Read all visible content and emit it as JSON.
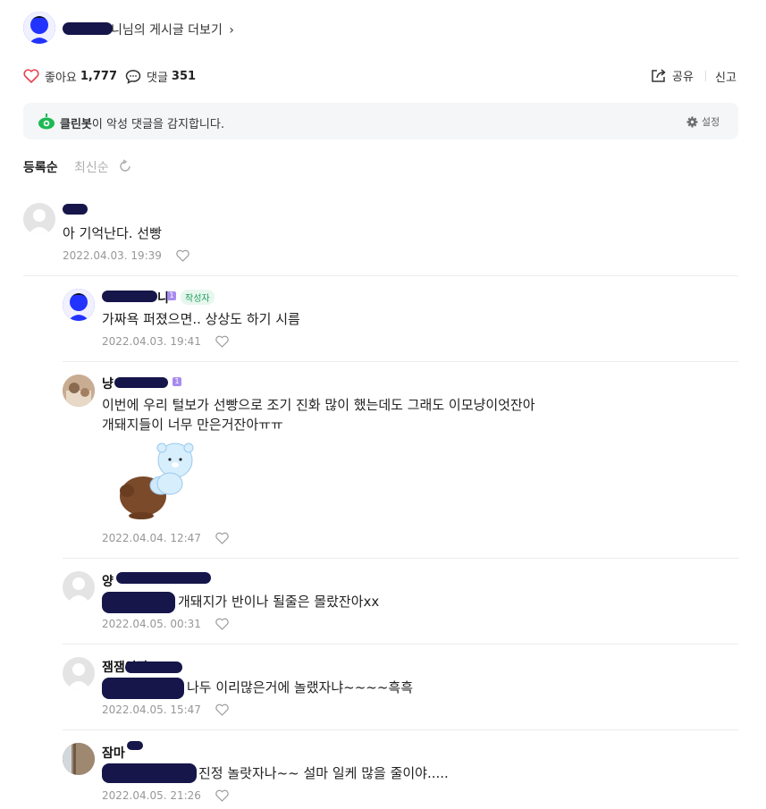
{
  "header": {
    "more_posts_suffix": "니님의 게시글 더보기",
    "more_posts_arrow": "›"
  },
  "actions": {
    "like_label": "좋아요",
    "like_count": "1,777",
    "comment_label": "댓글",
    "comment_count": "351",
    "share_label": "공유",
    "report_label": "신고"
  },
  "cleanbot": {
    "name": "클린봇",
    "message": "이 악성 댓글을 감지합니다.",
    "settings_label": "설정"
  },
  "sort": {
    "options": [
      "등록순",
      "최신순"
    ],
    "selected": "등록순"
  },
  "comments": [
    {
      "nick": "",
      "text": "아 기억난다. 선빵",
      "date": "2022.04.03. 19:39"
    },
    {
      "nick": "니",
      "author_tag": "작성자",
      "text": "가짜욕 퍼졌으면.. 상상도 하기 시름",
      "date": "2022.04.03. 19:41"
    },
    {
      "nick": "냥",
      "text_line1": "이번에 우리 털보가 선빵으로 조기 진화 많이 했는데도 그래도 이모냥이엇잔아",
      "text_line2": "개돼지들이 너무 만은거잔아ㅠㅠ",
      "date": "2022.04.04. 12:47"
    },
    {
      "nick": "양",
      "text": "개돼지가 반이나 될줄은 몰랐잔아xx",
      "date": "2022.04.05. 00:31"
    },
    {
      "nick": "잼잼이짱",
      "text": "나두 이리많은거에 놀랬자냐~~~~흑흑",
      "date": "2022.04.05. 15:47"
    },
    {
      "nick": "잠마",
      "text": "진정 놀랏자나~~ 설마 일케 많을 줄이야.....",
      "date": "2022.04.05. 21:26"
    }
  ],
  "colors": {
    "heart": "#e8414f",
    "cleanbot_green": "#1db954",
    "redaction": "#16164a"
  }
}
